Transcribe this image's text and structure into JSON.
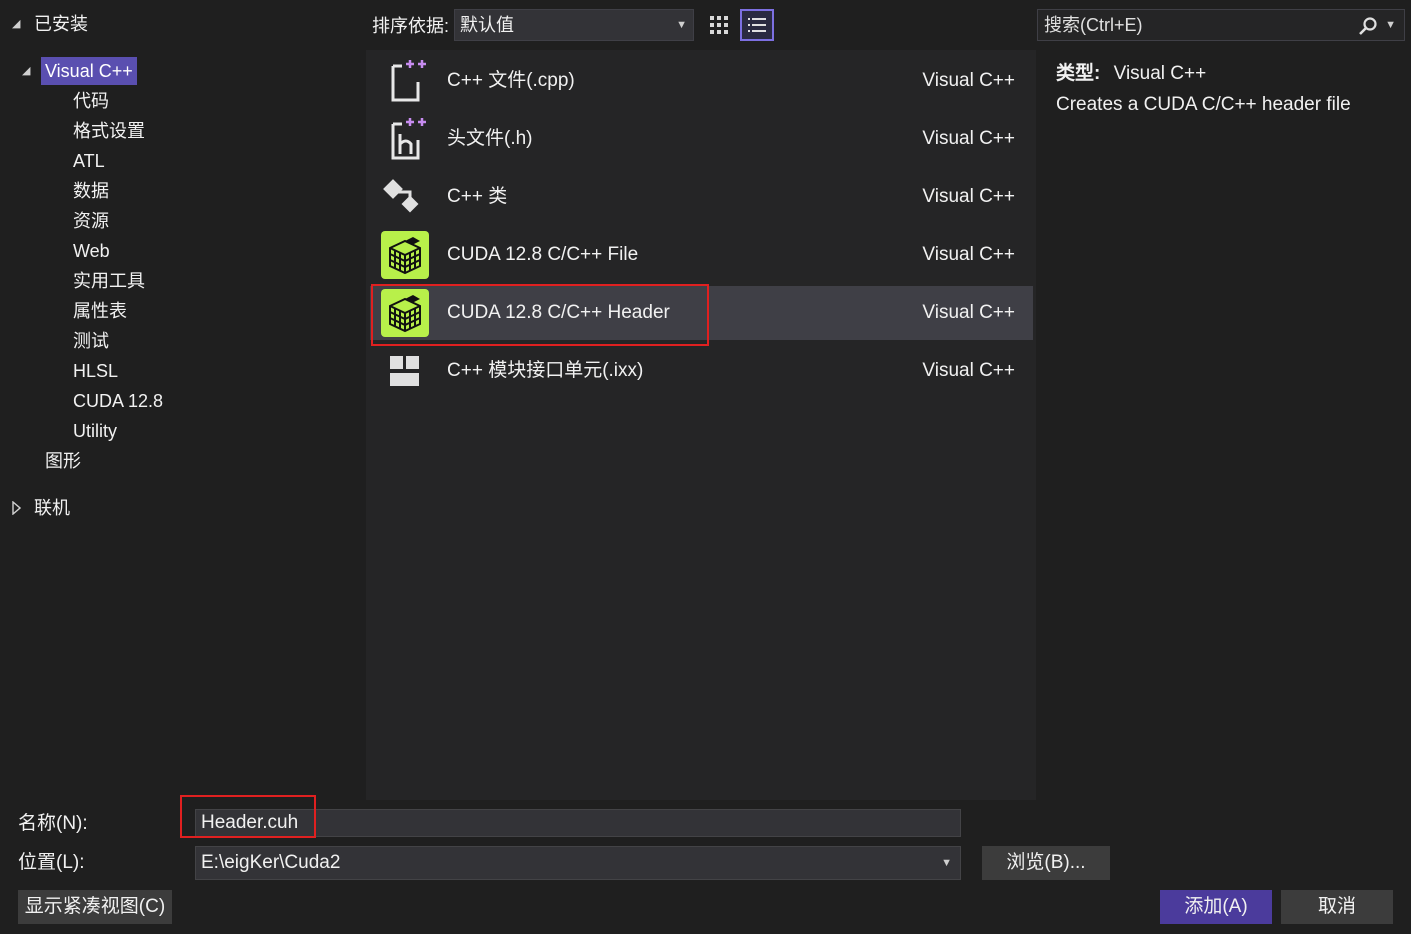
{
  "tree": {
    "installed": "已安装",
    "visual_cpp": "Visual C++",
    "items": [
      "代码",
      "格式设置",
      "ATL",
      "数据",
      "资源",
      "Web",
      "实用工具",
      "属性表",
      "测试",
      "HLSL",
      "CUDA 12.8",
      "Utility"
    ],
    "graphics": "图形",
    "online": "联机"
  },
  "toolbar": {
    "sort_label": "排序依据:",
    "sort_value": "默认值",
    "search_placeholder": "搜索(Ctrl+E)"
  },
  "templates": [
    {
      "name": "C++ 文件(.cpp)",
      "lang": "Visual C++",
      "icon": "cpp-file-icon"
    },
    {
      "name": "头文件(.h)",
      "lang": "Visual C++",
      "icon": "header-file-icon"
    },
    {
      "name": "C++ 类",
      "lang": "Visual C++",
      "icon": "cpp-class-icon"
    },
    {
      "name": "CUDA 12.8 C/C++ File",
      "lang": "Visual C++",
      "icon": "cuda-cube-icon"
    },
    {
      "name": "CUDA 12.8 C/C++ Header",
      "lang": "Visual C++",
      "icon": "cuda-cube-icon"
    },
    {
      "name": "C++ 模块接口单元(.ixx)",
      "lang": "Visual C++",
      "icon": "module-interface-icon"
    }
  ],
  "selected_template_index": 4,
  "details": {
    "type_label": "类型:",
    "type_value": "Visual C++",
    "description": "Creates a CUDA C/C++ header file"
  },
  "form": {
    "name_label": "名称(N):",
    "name_value": "Header.cuh",
    "location_label": "位置(L):",
    "location_value": "E:\\eigKer\\Cuda2",
    "browse_label": "浏览(B)...",
    "compact_view_label": "显示紧凑视图(C)",
    "add_label": "添加(A)",
    "cancel_label": "取消"
  },
  "colors": {
    "accent": "#5a4fb0",
    "primary_button": "#4b3b9c",
    "highlight_box": "#e02020",
    "cuda_green": "#b8f04a"
  }
}
